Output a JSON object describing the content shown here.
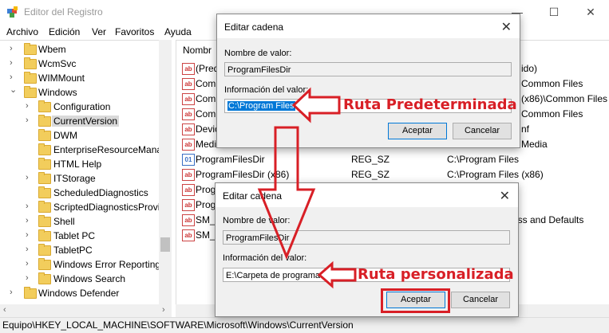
{
  "window": {
    "title": "Editor del Registro",
    "min_icon": "minimize-icon",
    "max_icon": "maximize-icon",
    "close_icon": "close-icon"
  },
  "menu": [
    "Archivo",
    "Edición",
    "Ver",
    "Favoritos",
    "Ayuda"
  ],
  "tree": [
    {
      "label": "Wbem",
      "chev": "›"
    },
    {
      "label": "WcmSvc",
      "chev": "›"
    },
    {
      "label": "WIMMount",
      "chev": "›"
    },
    {
      "label": "Windows",
      "chev": "⌄"
    },
    {
      "label": "Configuration",
      "chev": "›"
    },
    {
      "label": "CurrentVersion",
      "chev": "›"
    },
    {
      "label": "DWM",
      "chev": ""
    },
    {
      "label": "EnterpriseResourceMana",
      "chev": ""
    },
    {
      "label": "HTML Help",
      "chev": ""
    },
    {
      "label": "ITStorage",
      "chev": "›"
    },
    {
      "label": "ScheduledDiagnostics",
      "chev": ""
    },
    {
      "label": "ScriptedDiagnosticsProvi",
      "chev": "›"
    },
    {
      "label": "Shell",
      "chev": "›"
    },
    {
      "label": "Tablet PC",
      "chev": "›"
    },
    {
      "label": "TabletPC",
      "chev": "›"
    },
    {
      "label": "Windows Error Reporting",
      "chev": "›"
    },
    {
      "label": "Windows Search",
      "chev": "›"
    },
    {
      "label": "Windows Defender",
      "chev": "›"
    }
  ],
  "values_header": {
    "name": "Nombr"
  },
  "values": [
    {
      "name": "(Pred",
      "type": "",
      "data": "ido)",
      "icon": "string-value-icon"
    },
    {
      "name": "Comm",
      "type": "",
      "data": "Common Files",
      "icon": "string-value-icon"
    },
    {
      "name": "Comm",
      "type": "",
      "data": "(x86)\\Common Files",
      "icon": "string-value-icon"
    },
    {
      "name": "Comm",
      "type": "",
      "data": "Common Files",
      "icon": "string-value-icon"
    },
    {
      "name": "Devic",
      "type": "",
      "data": "nf",
      "icon": "string-value-icon"
    },
    {
      "name": "Medi",
      "type": "",
      "data": "Media",
      "icon": "string-value-icon"
    },
    {
      "name": "ProgramFilesDir",
      "type": "REG_SZ",
      "data": "C:\\Program Files",
      "icon": "binary-value-icon"
    },
    {
      "name": "ProgramFilesDir (x86)",
      "type": "REG_SZ",
      "data": "C:\\Program Files (x86)",
      "icon": "string-value-icon"
    },
    {
      "name": "Prog",
      "type": "",
      "data": "",
      "icon": "string-value-icon"
    },
    {
      "name": "Prog",
      "type": "",
      "data": "",
      "icon": "string-value-icon"
    },
    {
      "name": "SM_C",
      "type": "",
      "data": "ess and Defaults",
      "icon": "string-value-icon"
    },
    {
      "name": "SM_C",
      "type": "",
      "data": "",
      "icon": "string-value-icon"
    }
  ],
  "status": "Equipo\\HKEY_LOCAL_MACHINE\\SOFTWARE\\Microsoft\\Windows\\CurrentVersion",
  "dialog1": {
    "title": "Editar cadena",
    "name_label": "Nombre de valor:",
    "name_value": "ProgramFilesDir",
    "info_label": "Información del valor:",
    "info_value": "C:\\Program Files",
    "ok": "Aceptar",
    "cancel": "Cancelar"
  },
  "dialog2": {
    "title": "Editar cadena",
    "name_label": "Nombre de valor:",
    "name_value": "ProgramFilesDir",
    "info_label": "Información del valor:",
    "info_value": "E:\\Carpeta de programas",
    "ok": "Aceptar",
    "cancel": "Cancelar"
  },
  "annotations": {
    "default": "Ruta Predeterminada",
    "custom": "Ruta personalizada",
    "color": "#d81f26"
  }
}
